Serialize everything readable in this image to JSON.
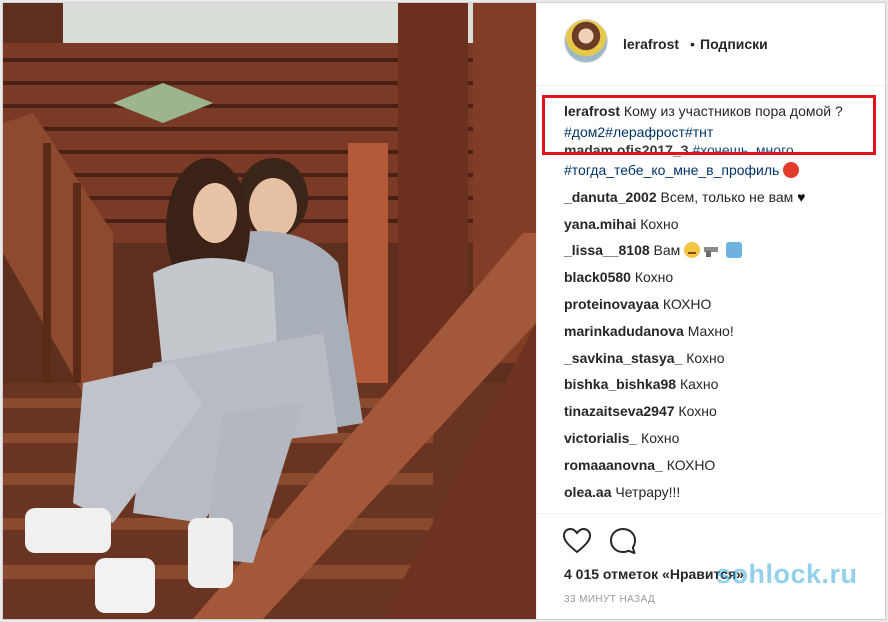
{
  "post": {
    "header": {
      "username": "lerafrost",
      "separator": "•",
      "follow_label": "Подписки"
    },
    "caption": {
      "username": "lerafrost",
      "text": "Кому из участников пора домой ?",
      "hashtags": "#дом2#лерафрост#тнт"
    },
    "clipped_comment": {
      "username": "madam.ofis2017_3",
      "text": "#хочешь_много"
    },
    "comments": [
      {
        "username": "",
        "text": "#тогда_тебе_ко_мне_в_профиль",
        "emoji": "red-circle"
      },
      {
        "username": "_danuta_2002",
        "text": "Всем, только не вам",
        "emoji": "black-heart"
      },
      {
        "username": "yana.mihai",
        "text": "Кохно",
        "emoji": ""
      },
      {
        "username": "_lissa__8108",
        "text": "Вам",
        "emoji": "sad-face gun raised-hands"
      },
      {
        "username": "black0580",
        "text": "Кохно",
        "emoji": ""
      },
      {
        "username": "proteinovayaa",
        "text": "КОХНО",
        "emoji": ""
      },
      {
        "username": "marinkadudanova",
        "text": "Махно!",
        "emoji": ""
      },
      {
        "username": "_savkina_stasya_",
        "text": "Кохно",
        "emoji": ""
      },
      {
        "username": "bishka_bishka98",
        "text": "Кахно",
        "emoji": ""
      },
      {
        "username": "tinazaitseva2947",
        "text": "Кохно",
        "emoji": ""
      },
      {
        "username": "victorialis_",
        "text": "Кохно",
        "emoji": ""
      },
      {
        "username": "romaaanovna_",
        "text": "КОХНО",
        "emoji": ""
      },
      {
        "username": "olea.aa",
        "text": "Четрару!!!",
        "emoji": ""
      }
    ],
    "likes_text": "4 015 отметок «Нравится»",
    "time_text": "33 минут назад",
    "icons": [
      "heart-icon",
      "comment-icon"
    ]
  },
  "watermark": "sohlock.ru",
  "colors": {
    "hashtag": "#003569",
    "highlight": "#e2131e",
    "text": "#262626",
    "muted": "#999999"
  }
}
